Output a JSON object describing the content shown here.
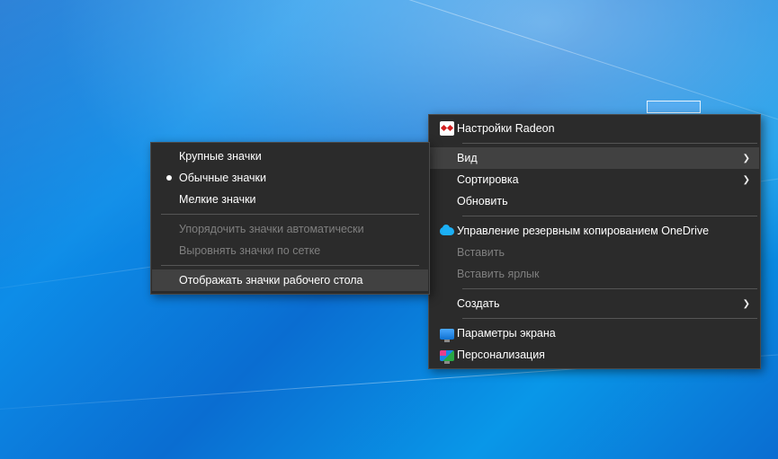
{
  "main_menu": {
    "radeon": "Настройки Radeon",
    "view": "Вид",
    "sort": "Сортировка",
    "refresh": "Обновить",
    "onedrive": "Управление резервным копированием OneDrive",
    "paste": "Вставить",
    "paste_shortcut": "Вставить ярлык",
    "create": "Создать",
    "display_settings": "Параметры экрана",
    "personalize": "Персонализация"
  },
  "view_submenu": {
    "large_icons": "Крупные значки",
    "medium_icons": "Обычные значки",
    "small_icons": "Мелкие значки",
    "auto_arrange": "Упорядочить значки автоматически",
    "align_grid": "Выровнять значки по сетке",
    "show_icons": "Отображать значки рабочего стола"
  }
}
